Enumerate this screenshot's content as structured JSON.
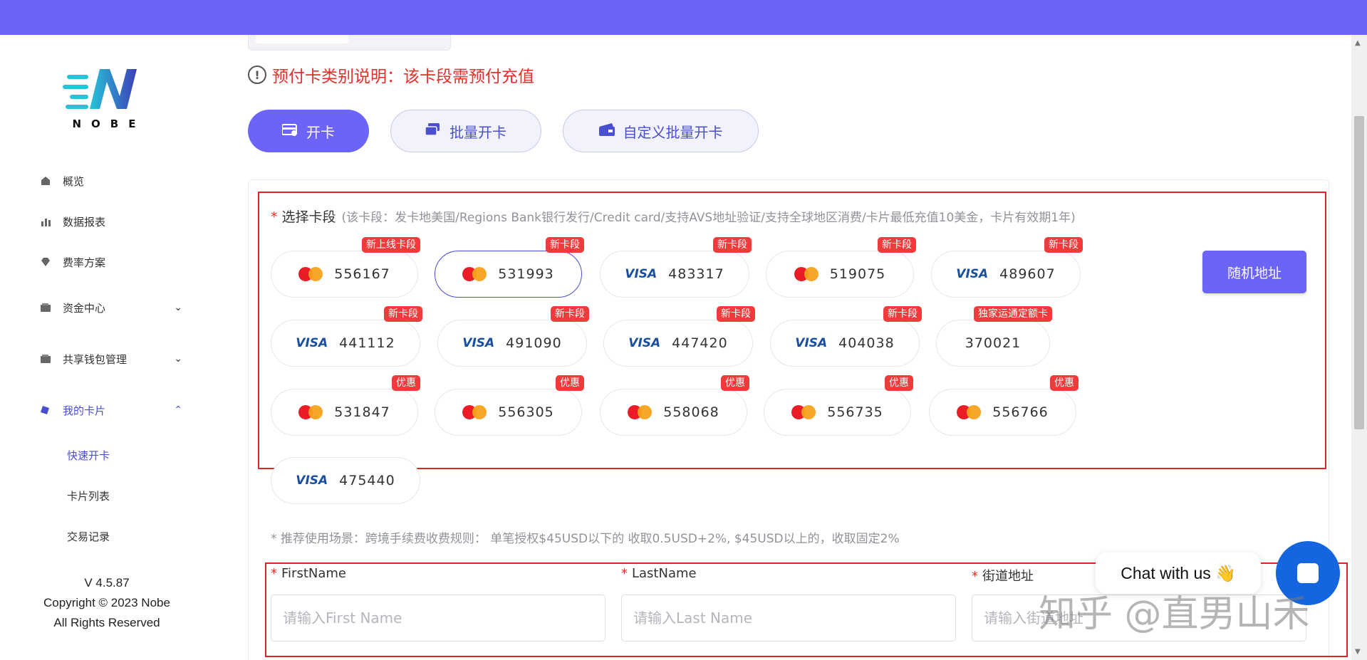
{
  "logo": {
    "text": "NOBE"
  },
  "sidebar": {
    "items": [
      {
        "label": "概览",
        "icon": "home-icon"
      },
      {
        "label": "数据报表",
        "icon": "bar-chart-icon"
      },
      {
        "label": "费率方案",
        "icon": "diamond-icon"
      },
      {
        "label": "资金中心",
        "icon": "wallet-icon",
        "chevron": "down"
      },
      {
        "label": "共享钱包管理",
        "icon": "wallet-icon",
        "chevron": "down"
      },
      {
        "label": "我的卡片",
        "icon": "card-icon",
        "chevron": "up",
        "active": true
      }
    ],
    "sub_items": [
      {
        "label": "快速开卡",
        "active": true
      },
      {
        "label": "卡片列表"
      },
      {
        "label": "交易记录"
      }
    ],
    "version": "V 4.5.87",
    "copyright": "Copyright © 2023 Nobe",
    "rights": "All Rights Reserved"
  },
  "notice": {
    "text": "预付卡类别说明：该卡段需预付充值"
  },
  "tabs": [
    {
      "label": "开卡",
      "active": true
    },
    {
      "label": "批量开卡"
    },
    {
      "label": "自定义批量开卡"
    }
  ],
  "card_section": {
    "label": "选择卡段",
    "description": "(该卡段：发卡地美国/Regions Bank银行发行/Credit card/支持AVS地址验证/支持全球地区消费/卡片最低充值10美金，卡片有效期1年)",
    "random_button": "随机地址",
    "cards": [
      {
        "number": "556167",
        "brand": "mastercard",
        "badge": "新上线卡段"
      },
      {
        "number": "531993",
        "brand": "mastercard",
        "badge": "新卡段",
        "selected": true
      },
      {
        "number": "483317",
        "brand": "visa",
        "badge": "新卡段"
      },
      {
        "number": "519075",
        "brand": "mastercard",
        "badge": "新卡段"
      },
      {
        "number": "489607",
        "brand": "visa",
        "badge": "新卡段"
      },
      {
        "number": "441112",
        "brand": "visa",
        "badge": "新卡段"
      },
      {
        "number": "491090",
        "brand": "visa",
        "badge": "新卡段"
      },
      {
        "number": "447420",
        "brand": "visa",
        "badge": "新卡段"
      },
      {
        "number": "404038",
        "brand": "visa",
        "badge": "新卡段"
      },
      {
        "number": "370021",
        "brand": "none",
        "badge": "独家运通定额卡"
      },
      {
        "number": "531847",
        "brand": "mastercard",
        "badge": "优惠"
      },
      {
        "number": "556305",
        "brand": "mastercard",
        "badge": "优惠"
      },
      {
        "number": "558068",
        "brand": "mastercard",
        "badge": "优惠"
      },
      {
        "number": "556735",
        "brand": "mastercard",
        "badge": "优惠"
      },
      {
        "number": "556766",
        "brand": "mastercard",
        "badge": "优惠"
      },
      {
        "number": "475440",
        "brand": "visa",
        "badge": ""
      }
    ],
    "visa_text": "VISA"
  },
  "tip": {
    "text": "* 推荐使用场景：跨境手续费收费规则： 单笔授权$45USD以下的 收取0.5USD+2%, $45USD以上的，收取固定2%"
  },
  "form": {
    "first_name": {
      "label": "FirstName",
      "placeholder": "请输入First Name"
    },
    "last_name": {
      "label": "LastName",
      "placeholder": "请输入Last Name"
    },
    "street": {
      "label": "街道地址",
      "placeholder": "请输入街道地址"
    }
  },
  "chat": {
    "text": "Chat with us 👋"
  },
  "watermark": {
    "text": "知乎 @直男山禾"
  },
  "colors": {
    "accent": "#6c63f8",
    "brand_blue": "#4a4ed0",
    "danger": "#e6302b",
    "badge": "#ef3b3b"
  }
}
